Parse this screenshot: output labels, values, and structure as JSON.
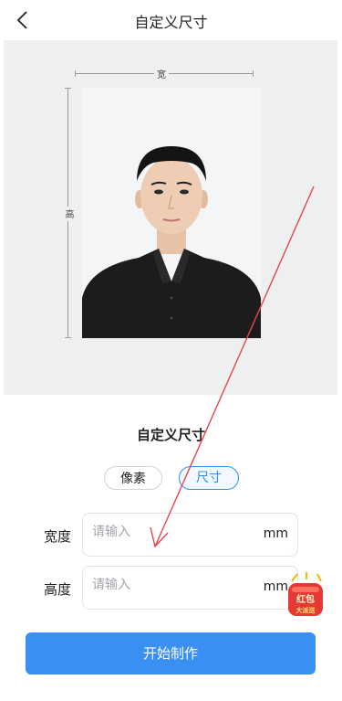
{
  "header": {
    "title": "自定义尺寸"
  },
  "preview": {
    "width_label": "宽",
    "height_label": "高"
  },
  "form": {
    "title": "自定义尺寸",
    "segments": {
      "pixel": "像素",
      "size": "尺寸",
      "selected": "尺寸"
    },
    "width": {
      "label": "宽度",
      "placeholder": "请输入",
      "unit": "mm"
    },
    "height": {
      "label": "高度",
      "placeholder": "请输入",
      "unit": "mm"
    },
    "start_label": "开始制作"
  },
  "promo": {
    "line1": "红包",
    "line2": "大派送"
  },
  "colors": {
    "accent": "#3a8ff2",
    "preview_bg": "#eeeff1",
    "annotation_arrow": "#e8454a"
  }
}
